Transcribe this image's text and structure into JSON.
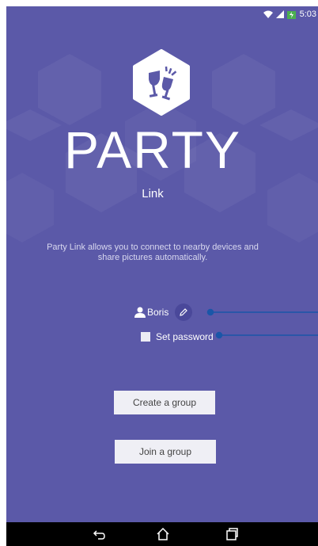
{
  "status_bar": {
    "time": "5:03",
    "icons": [
      "wifi-icon",
      "signal-icon",
      "battery-charging-icon"
    ]
  },
  "app": {
    "logo_icon": "toast-glasses-icon",
    "title": "PARTY",
    "subtitle": "Link",
    "description": "Party Link allows you to connect to nearby devices and share pictures automatically."
  },
  "user": {
    "name": "Boris",
    "icon": "person-icon",
    "edit_icon": "pencil-icon"
  },
  "password": {
    "label": "Set password",
    "checked": false
  },
  "buttons": {
    "create_group": "Create a group",
    "join_group": "Join a group"
  },
  "nav_bar": {
    "icons": [
      "back-icon",
      "home-icon",
      "recent-apps-icon"
    ]
  },
  "colors": {
    "background": "#5b59a8",
    "button_bg": "#efeff5",
    "callout": "#1a56a8"
  }
}
